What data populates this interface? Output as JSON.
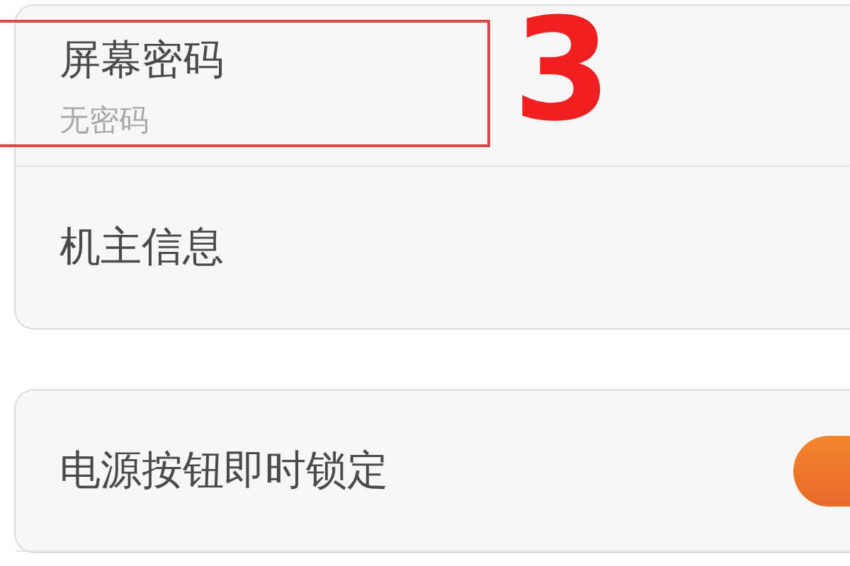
{
  "groups": [
    {
      "items": [
        {
          "title": "屏幕密码",
          "subtitle": "无密码",
          "highlighted": true
        },
        {
          "title": "机主信息"
        }
      ]
    },
    {
      "items": [
        {
          "title": "电源按钮即时锁定",
          "on": true
        }
      ]
    }
  ],
  "annotation": {
    "label": "3"
  }
}
